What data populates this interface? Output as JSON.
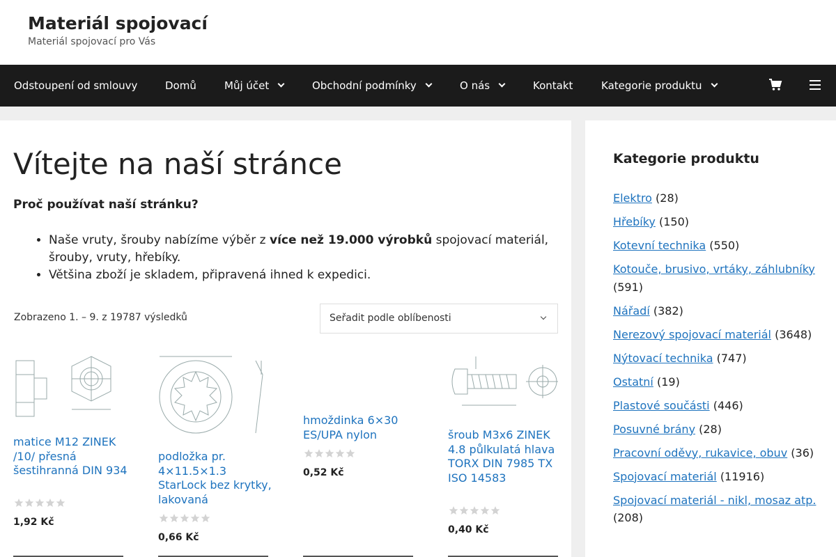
{
  "site": {
    "title": "Materiál spojovací",
    "description": "Materiál spojovací pro Vás"
  },
  "nav": {
    "items": [
      {
        "label": "Odstoupení od smlouvy",
        "dropdown": false
      },
      {
        "label": "Domů",
        "dropdown": false
      },
      {
        "label": "Můj účet",
        "dropdown": true
      },
      {
        "label": "Obchodní podmínky",
        "dropdown": true
      },
      {
        "label": "O nás",
        "dropdown": true
      },
      {
        "label": "Kontakt",
        "dropdown": false
      },
      {
        "label": "Kategorie produktu",
        "dropdown": true
      }
    ],
    "cart_icon": "cart-icon",
    "menu_icon": "hamburger-menu-icon"
  },
  "main": {
    "title": "Vítejte na naší stránce",
    "why_heading": "Proč používat naší stránku?",
    "bullet1_pre": "Naše vruty, šrouby nabízíme výběr z ",
    "bullet1_bold": "více než 19.000 výrobků",
    "bullet1_post": " spojovací materiál, šrouby, vruty, hřebíky.",
    "bullet2": "Většina zboží je skladem, připravená ihned k expedici.",
    "result_count": "Zobrazeno 1. – 9. z 19787 výsledků",
    "sort_selected": "Seřadit podle oblíbenosti"
  },
  "products": [
    {
      "name": "matice M12 ZINEK /10/ přesná šestihranná DIN 934",
      "price": "1,92 Kč",
      "rating": 0
    },
    {
      "name": "podložka pr. 4×11.5×1.3 StarLock bez krytky, lakovaná",
      "price": "0,66 Kč",
      "rating": 0
    },
    {
      "name": "hmoždinka 6×30 ES/UPA nylon",
      "price": "0,52 Kč",
      "rating": 0
    },
    {
      "name": "šroub M3x6 ZINEK 4.8 půlkulatá hlava TORX DIN 7985 TX ISO 14583",
      "price": "0,40 Kč",
      "rating": 0
    }
  ],
  "sidebar": {
    "title": "Kategorie produktu",
    "categories": [
      {
        "name": "Elektro",
        "count": "(28)"
      },
      {
        "name": "Hřebíky",
        "count": "(150)"
      },
      {
        "name": "Kotevní technika",
        "count": "(550)"
      },
      {
        "name": "Kotouče, brusivo, vrtáky, záhlubníky",
        "count": "(591)"
      },
      {
        "name": "Nářadí",
        "count": "(382)"
      },
      {
        "name": "Nerezový spojovací materiál",
        "count": "(3648)"
      },
      {
        "name": "Nýtovací technika",
        "count": "(747)"
      },
      {
        "name": "Ostatní",
        "count": "(19)"
      },
      {
        "name": "Plastové součásti",
        "count": "(446)"
      },
      {
        "name": "Posuvné brány",
        "count": "(28)"
      },
      {
        "name": "Pracovní oděvy, rukavice, obuv",
        "count": "(36)"
      },
      {
        "name": "Spojovací materiál",
        "count": "(11916)"
      },
      {
        "name": "Spojovací materiál - nikl, mosaz atp.",
        "count": "(208)"
      }
    ]
  },
  "colors": {
    "link": "#1e73be",
    "nav_bg": "#1b1b1b",
    "page_bg": "#efefef"
  }
}
